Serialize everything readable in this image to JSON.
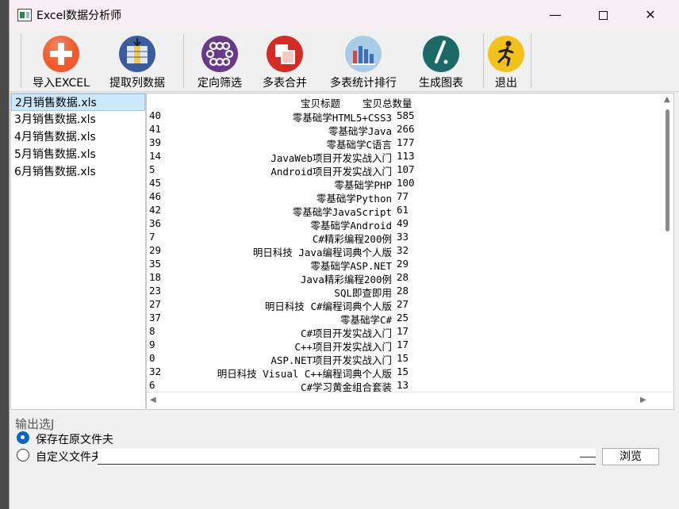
{
  "window": {
    "title": "Excel数据分析师"
  },
  "toolbar": {
    "buttons": [
      {
        "label": "导入EXCEL",
        "icon": "plus-icon",
        "color": "#f05a2a"
      },
      {
        "label": "提取列数据",
        "icon": "column-extract-icon",
        "color": "#3b5da0"
      },
      {
        "label": "定向筛选",
        "icon": "filter-dots-icon",
        "color": "#6a3a8a"
      },
      {
        "label": "多表合并",
        "icon": "merge-sheets-icon",
        "color": "#d42b25"
      },
      {
        "label": "多表统计排行",
        "icon": "bar-chart-icon",
        "color": "#6fa8d6"
      },
      {
        "label": "生成图表",
        "icon": "pen-chart-icon",
        "color": "#1c6a67"
      },
      {
        "label": "退出",
        "icon": "running-man-icon",
        "color": "#f3c21a"
      }
    ]
  },
  "files": [
    "2月销售数据.xls",
    "3月销售数据.xls",
    "4月销售数据.xls",
    "5月销售数据.xls",
    "6月销售数据.xls"
  ],
  "results": {
    "col_title": "宝贝标题",
    "col_count": "宝贝总数量",
    "rows": [
      {
        "idx": "40",
        "title": "零基础学HTML5+CSS3",
        "qty": "585"
      },
      {
        "idx": "41",
        "title": "零基础学Java",
        "qty": "266"
      },
      {
        "idx": "39",
        "title": "零基础学C语言",
        "qty": "177"
      },
      {
        "idx": "14",
        "title": "JavaWeb项目开发实战入门",
        "qty": "113"
      },
      {
        "idx": "5",
        "title": "Android项目开发实战入门",
        "qty": "107"
      },
      {
        "idx": "45",
        "title": "零基础学PHP",
        "qty": "100"
      },
      {
        "idx": "46",
        "title": "零基础学Python",
        "qty": "77"
      },
      {
        "idx": "42",
        "title": "零基础学JavaScript",
        "qty": "61"
      },
      {
        "idx": "36",
        "title": "零基础学Android",
        "qty": "49"
      },
      {
        "idx": "7",
        "title": "C#精彩编程200例",
        "qty": "33"
      },
      {
        "idx": "29",
        "title": "明日科技 Java编程词典个人版",
        "qty": "32"
      },
      {
        "idx": "35",
        "title": "零基础学ASP.NET",
        "qty": "29"
      },
      {
        "idx": "18",
        "title": "Java精彩编程200例",
        "qty": "28"
      },
      {
        "idx": "23",
        "title": "SQL即查即用",
        "qty": "28"
      },
      {
        "idx": "27",
        "title": "明日科技 C#编程词典个人版",
        "qty": "27"
      },
      {
        "idx": "37",
        "title": "零基础学C#",
        "qty": "25"
      },
      {
        "idx": "8",
        "title": "C#项目开发实战入门",
        "qty": "17"
      },
      {
        "idx": "9",
        "title": "C++项目开发实战入门",
        "qty": "17"
      },
      {
        "idx": "0",
        "title": "ASP.NET项目开发实战入门",
        "qty": "15"
      },
      {
        "idx": "32",
        "title": "明日科技 Visual C++编程词典个人版",
        "qty": "15"
      },
      {
        "idx": "6",
        "title": "C#学习黄金组合套装",
        "qty": "13"
      }
    ]
  },
  "output": {
    "title": "输出选J",
    "opt_original": "保存在原文件夫",
    "opt_custom": "自定义文件夫",
    "path_value": "",
    "browse_label": "浏览"
  }
}
